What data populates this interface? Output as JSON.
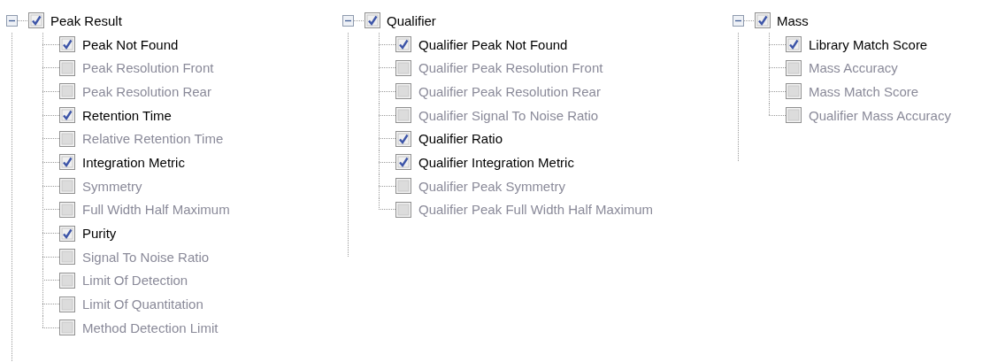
{
  "groups": [
    {
      "label": "Peak Result",
      "expanded": true,
      "checked": true,
      "items": [
        {
          "label": "Peak Not Found",
          "checked": true
        },
        {
          "label": "Peak Resolution Front",
          "checked": false
        },
        {
          "label": "Peak Resolution Rear",
          "checked": false
        },
        {
          "label": "Retention Time",
          "checked": true
        },
        {
          "label": "Relative Retention Time",
          "checked": false
        },
        {
          "label": "Integration Metric",
          "checked": true
        },
        {
          "label": "Symmetry",
          "checked": false
        },
        {
          "label": "Full Width Half Maximum",
          "checked": false
        },
        {
          "label": "Purity",
          "checked": true
        },
        {
          "label": "Signal To Noise Ratio",
          "checked": false
        },
        {
          "label": "Limit Of Detection",
          "checked": false
        },
        {
          "label": "Limit Of Quantitation",
          "checked": false
        },
        {
          "label": "Method Detection Limit",
          "checked": false
        }
      ]
    },
    {
      "label": "Qualifier",
      "expanded": true,
      "checked": true,
      "items": [
        {
          "label": "Qualifier Peak Not Found",
          "checked": true
        },
        {
          "label": "Qualifier Peak Resolution Front",
          "checked": false
        },
        {
          "label": "Qualifier Peak Resolution Rear",
          "checked": false
        },
        {
          "label": "Qualifier Signal To Noise Ratio",
          "checked": false
        },
        {
          "label": "Qualifier Ratio",
          "checked": true
        },
        {
          "label": "Qualifier Integration Metric",
          "checked": true
        },
        {
          "label": "Qualifier Peak Symmetry",
          "checked": false
        },
        {
          "label": "Qualifier Peak Full Width Half Maximum",
          "checked": false
        }
      ]
    },
    {
      "label": "Mass",
      "expanded": true,
      "checked": true,
      "items": [
        {
          "label": "Library Match Score",
          "checked": true
        },
        {
          "label": "Mass Accuracy",
          "checked": false
        },
        {
          "label": "Mass Match Score",
          "checked": false
        },
        {
          "label": "Qualifier Mass Accuracy",
          "checked": false
        }
      ]
    }
  ]
}
